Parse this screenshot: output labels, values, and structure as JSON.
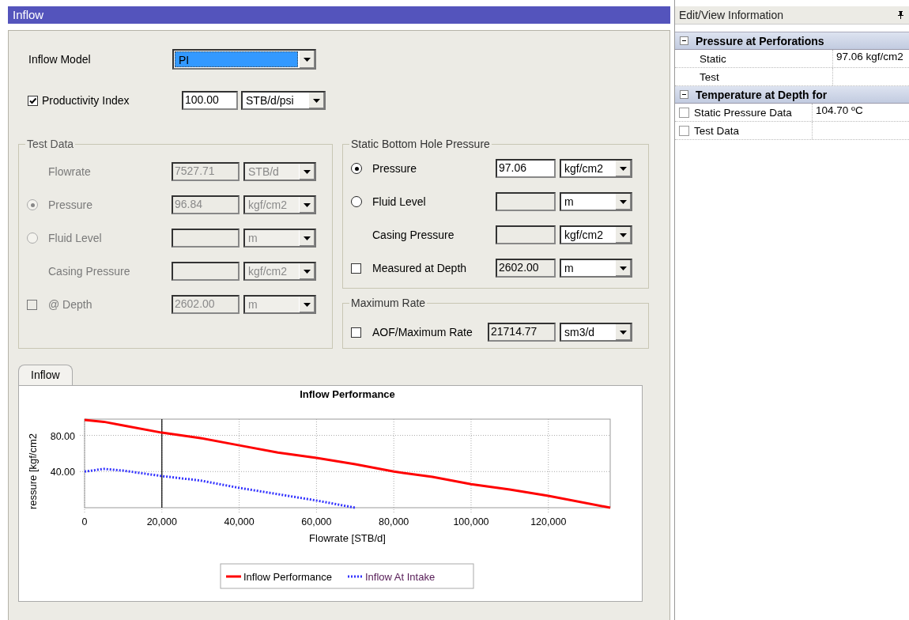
{
  "window": {
    "title": "Inflow"
  },
  "inflow_model": {
    "label": "Inflow Model",
    "value": "PI",
    "focused": true
  },
  "productivity_index": {
    "label": "Productivity Index",
    "checked": true,
    "value": "100.00",
    "unit": "STB/d/psi"
  },
  "groups": [
    {
      "title": "Test Data",
      "disabled": true,
      "rows": [
        {
          "kind": "plain",
          "label": "Flowrate",
          "value": "7527.71",
          "field_disabled": true,
          "unit": "STB/d"
        },
        {
          "kind": "radio",
          "label": "Pressure",
          "selected": true,
          "value": "96.84",
          "field_disabled": true,
          "unit": "kgf/cm2"
        },
        {
          "kind": "radio",
          "label": "Fluid Level",
          "selected": false,
          "field_disabled": true,
          "unit": "m"
        },
        {
          "kind": "plain",
          "label": "Casing Pressure",
          "field_disabled": true,
          "unit": "kgf/cm2"
        },
        {
          "kind": "checkbox",
          "label": "@ Depth",
          "checked": false,
          "value": "2602.00",
          "field_disabled": true,
          "unit": "m"
        }
      ]
    },
    {
      "title": "Static Bottom Hole Pressure",
      "disabled": false,
      "rows": [
        {
          "kind": "radio",
          "label": "Pressure",
          "selected": true,
          "value": "97.06",
          "field_disabled": false,
          "unit": "kgf/cm2"
        },
        {
          "kind": "radio",
          "label": "Fluid Level",
          "selected": false,
          "field_disabled": true,
          "unit": "m"
        },
        {
          "kind": "plain",
          "label": "Casing Pressure",
          "field_disabled": true,
          "unit": "kgf/cm2"
        },
        {
          "kind": "checkbox",
          "label": "Measured at Depth",
          "checked": false,
          "value": "2602.00",
          "field_disabled": true,
          "unit": "m"
        }
      ]
    },
    {
      "title": "Maximum Rate",
      "disabled": false,
      "rows": [
        {
          "kind": "checkbox",
          "label": "AOF/Maximum Rate",
          "checked": false,
          "value": "21714.77",
          "field_disabled": true,
          "unit": "sm3/d"
        }
      ]
    }
  ],
  "chart_tabs": [
    {
      "label": "Inflow",
      "selected": true
    }
  ],
  "chart": {
    "chart_data": {
      "type": "line",
      "title": "Inflow Performance",
      "xlabel": "Flowrate [STB/d]",
      "ylabel": "ressure [kgf/cm2",
      "x": [
        0,
        5000,
        10000,
        20000,
        30000,
        40000,
        50000,
        60000,
        70000,
        80000,
        90000,
        100000,
        110000,
        120000,
        136000
      ],
      "series": [
        {
          "name": "Inflow Performance",
          "color": "#ff0000",
          "line_style": "solid",
          "values": [
            97,
            95,
            91,
            83,
            77,
            69,
            61,
            55,
            48,
            40,
            34,
            26,
            20,
            13,
            0
          ]
        },
        {
          "name": "Inflow At Intake",
          "color": "#3333ff",
          "line_style": "dotted",
          "values": [
            40,
            43,
            41,
            35,
            30,
            22,
            15,
            8,
            0,
            null,
            null,
            null,
            null,
            null,
            null
          ]
        }
      ],
      "xlim": [
        0,
        136000
      ],
      "ylim": [
        0,
        98
      ],
      "xticks": [
        {
          "value": 0,
          "label": "0"
        },
        {
          "value": 20000,
          "label": "20,000"
        },
        {
          "value": 40000,
          "label": "40,000"
        },
        {
          "value": 60000,
          "label": "60,000"
        },
        {
          "value": 80000,
          "label": "80,000"
        },
        {
          "value": 100000,
          "label": "100,000"
        },
        {
          "value": 120000,
          "label": "120,000"
        }
      ],
      "yticks": [
        {
          "value": 40,
          "label": "40.00"
        },
        {
          "value": 80,
          "label": "80.00"
        }
      ],
      "ref_lines": [
        {
          "axis": "x",
          "value": 20000,
          "color": "#000000"
        }
      ],
      "grid": true,
      "legend": "bottom"
    }
  },
  "properties": {
    "title": "Edit/View Information",
    "categories": [
      {
        "title": "Pressure at Perforations",
        "expanded": true,
        "rows": [
          {
            "kind": "plain",
            "label": "Static",
            "value": "97.06 kgf/cm2"
          },
          {
            "kind": "plain",
            "label": "Test"
          }
        ]
      },
      {
        "title": "Temperature at Depth for",
        "expanded": true,
        "rows": [
          {
            "kind": "checkbox",
            "label": "Static Pressure Data",
            "checked": false,
            "value": "104.70 ºC"
          },
          {
            "kind": "checkbox",
            "label": "Test Data",
            "checked": false
          }
        ]
      }
    ]
  }
}
